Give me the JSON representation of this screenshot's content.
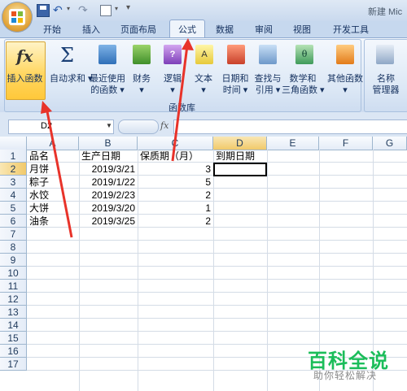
{
  "window": {
    "title": "新建 Mic"
  },
  "tabs": [
    {
      "label": "开始"
    },
    {
      "label": "插入"
    },
    {
      "label": "页面布局"
    },
    {
      "label": "公式"
    },
    {
      "label": "数据"
    },
    {
      "label": "审阅"
    },
    {
      "label": "视图"
    },
    {
      "label": "开发工具"
    }
  ],
  "active_tab": "公式",
  "ribbon": {
    "insert_function": "插入函数",
    "autosum": "自动求和",
    "recent": [
      "最近使用",
      "的函数"
    ],
    "finance": "财务",
    "logic": "逻辑",
    "text": "文本",
    "datetime": [
      "日期和",
      "时间"
    ],
    "lookup": [
      "查找与",
      "引用"
    ],
    "math": [
      "数学和",
      "三角函数"
    ],
    "other": "其他函数",
    "name_manager": [
      "名称",
      "管理器"
    ],
    "group_label": "函数库"
  },
  "formula_bar": {
    "name_box": "D2",
    "fx": "fx",
    "formula": ""
  },
  "columns": [
    "A",
    "B",
    "C",
    "D",
    "E",
    "F",
    "G"
  ],
  "rows": [
    "1",
    "2",
    "3",
    "4",
    "5",
    "6",
    "7",
    "8",
    "9",
    "10",
    "11",
    "12",
    "13",
    "14",
    "15",
    "16",
    "17"
  ],
  "cells": {
    "header": [
      "品名",
      "生产日期",
      "保质期（月）",
      "到期日期"
    ],
    "data": [
      [
        "月饼",
        "2019/3/21",
        "3",
        ""
      ],
      [
        "粽子",
        "2019/1/22",
        "5",
        ""
      ],
      [
        "水饺",
        "2019/2/23",
        "2",
        ""
      ],
      [
        "大饼",
        "2019/3/20",
        "1",
        ""
      ],
      [
        "油条",
        "2019/3/25",
        "2",
        ""
      ]
    ]
  },
  "watermark": {
    "title": "百科全说",
    "subtitle": "助你轻松解决"
  },
  "colors": {
    "accent": "#e8332a",
    "selected_tab": "#eef4fb",
    "watermark": "#1bbd5a"
  }
}
